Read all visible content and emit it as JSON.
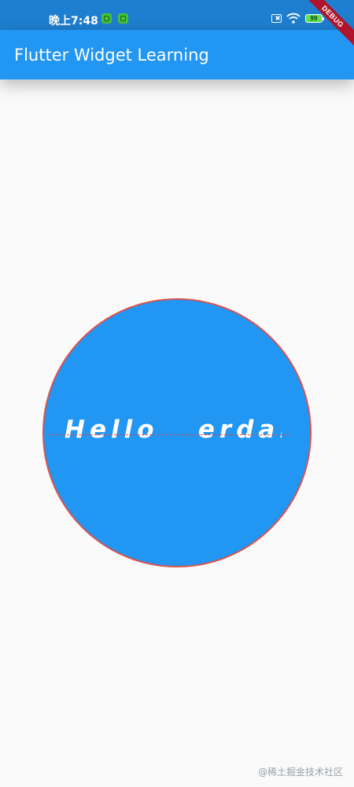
{
  "status_bar": {
    "time": "晚上7:48",
    "battery": "99",
    "icons": [
      "app-notification-icon",
      "app-notification-icon",
      "sim-card-off-icon",
      "wifi-icon",
      "battery-icon"
    ]
  },
  "debug_banner": "DEBUG",
  "app_bar": {
    "title": "Flutter Widget Learning"
  },
  "content": {
    "text": "Hello   erdai…"
  },
  "watermark": "@稀土掘金技术社区",
  "colors": {
    "app_bar": "#2196f3",
    "status_bar": "#1e7fd0",
    "circle_fill": "#2196f3",
    "circle_border": "#d9534f",
    "dash_line": "#e04848",
    "background": "#fafafa",
    "debug_banner": "#b0142a"
  }
}
